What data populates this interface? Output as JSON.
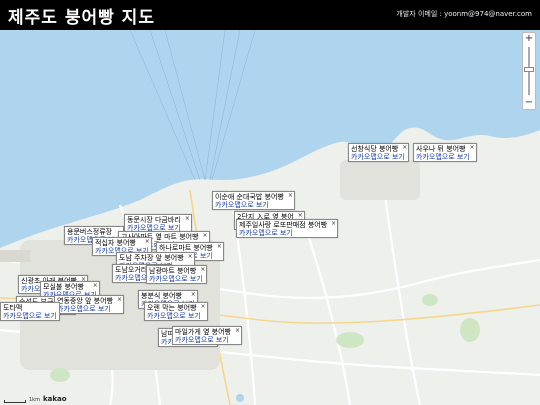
{
  "header": {
    "title": "제주도 붕어빵 지도",
    "contact": "개발자 이메일 : yoonm@974@naver.com"
  },
  "map": {
    "zoom_in": "+",
    "zoom_out": "−",
    "scale_label": "1km",
    "provider_logo": "kakao",
    "link_label": "카카오맵으로 보기",
    "colors": {
      "sea": "#aed4ee",
      "land": "#eef0ec",
      "road": "#ffffff",
      "water_text": "#5b8fbf"
    }
  },
  "markers": [
    {
      "name": "선창식당 붕어빵"
    },
    {
      "name": "사우나 뒤 붕어빵"
    },
    {
      "name": "이순애 순대국밥 붕어빵"
    },
    {
      "name": "동문시장 다금바리"
    },
    {
      "name": "2단지 入로 옆 붕어"
    },
    {
      "name": "용문버스정류장"
    },
    {
      "name": "고사아파트 옆 마트 붕어빵"
    },
    {
      "name": "제주일사랑 로또판매점 붕어빵"
    },
    {
      "name": "적십자 붕어빵"
    },
    {
      "name": "하나로마트 붕어빵"
    },
    {
      "name": "도남 주차장 앞 붕어빵"
    },
    {
      "name": "도남오거리"
    },
    {
      "name": "남광마트 붕어빵"
    },
    {
      "name": "신광초 아래 붕어빵"
    },
    {
      "name": "모실불 붕어빵"
    },
    {
      "name": "숙성도 부근"
    },
    {
      "name": "연동중앙 앞 붕어빵"
    },
    {
      "name": "도타맥"
    },
    {
      "name": "봉분식 붕어빵"
    },
    {
      "name": "오렌 막는 붕어빵"
    },
    {
      "name": "남띠"
    },
    {
      "name": "마일가게 옆 붕어빵"
    }
  ]
}
